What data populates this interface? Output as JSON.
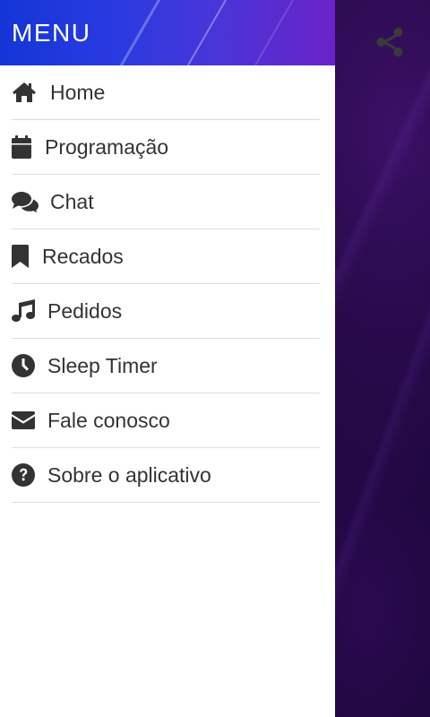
{
  "drawer": {
    "title": "MENU",
    "items": [
      {
        "label": "Home",
        "icon": "home-icon"
      },
      {
        "label": "Programação",
        "icon": "calendar-icon"
      },
      {
        "label": "Chat",
        "icon": "chat-icon"
      },
      {
        "label": "Recados",
        "icon": "bookmark-icon"
      },
      {
        "label": "Pedidos",
        "icon": "music-note-icon"
      },
      {
        "label": "Sleep Timer",
        "icon": "clock-icon"
      },
      {
        "label": "Fale conosco",
        "icon": "envelope-icon"
      },
      {
        "label": "Sobre o aplicativo",
        "icon": "question-circle-icon"
      }
    ]
  },
  "app": {
    "share_icon": "share-icon"
  },
  "colors": {
    "header_start": "#1436d6",
    "header_end": "#6a22c8",
    "icon_text": "#333333",
    "divider": "#dcdcdc",
    "background": "#12042a"
  }
}
